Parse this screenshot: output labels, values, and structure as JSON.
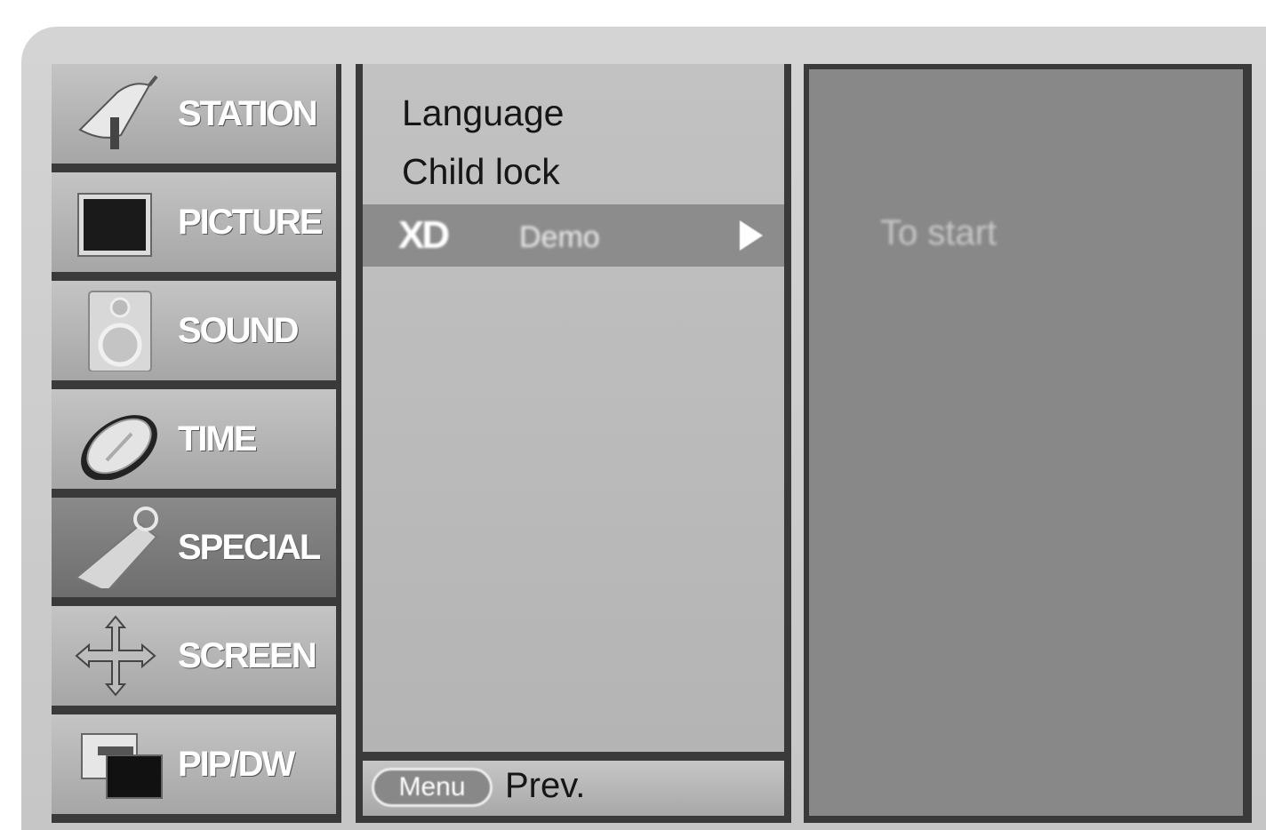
{
  "sidebar": {
    "items": [
      {
        "label": "STATION",
        "icon": "satellite-dish-icon"
      },
      {
        "label": "PICTURE",
        "icon": "tv-screen-icon"
      },
      {
        "label": "SOUND",
        "icon": "speaker-icon"
      },
      {
        "label": "TIME",
        "icon": "clock-icon"
      },
      {
        "label": "SPECIAL",
        "icon": "tag-icon",
        "active": true
      },
      {
        "label": "SCREEN",
        "icon": "move-arrows-icon"
      },
      {
        "label": "PIP/DW",
        "icon": "pip-windows-icon"
      }
    ]
  },
  "menu": {
    "items": [
      "Language",
      "Child lock"
    ],
    "selected": {
      "label_main": "XD",
      "label_sub": "Demo",
      "arrow": "right-arrow-icon"
    },
    "footer": {
      "key_label": "Menu",
      "label": "Prev."
    }
  },
  "subpanel": {
    "text": "To start"
  },
  "colors": {
    "frame": "#cccccc",
    "active_item": "#7a7a7a",
    "subpanel": "#888888",
    "border": "#3a3a3a"
  }
}
